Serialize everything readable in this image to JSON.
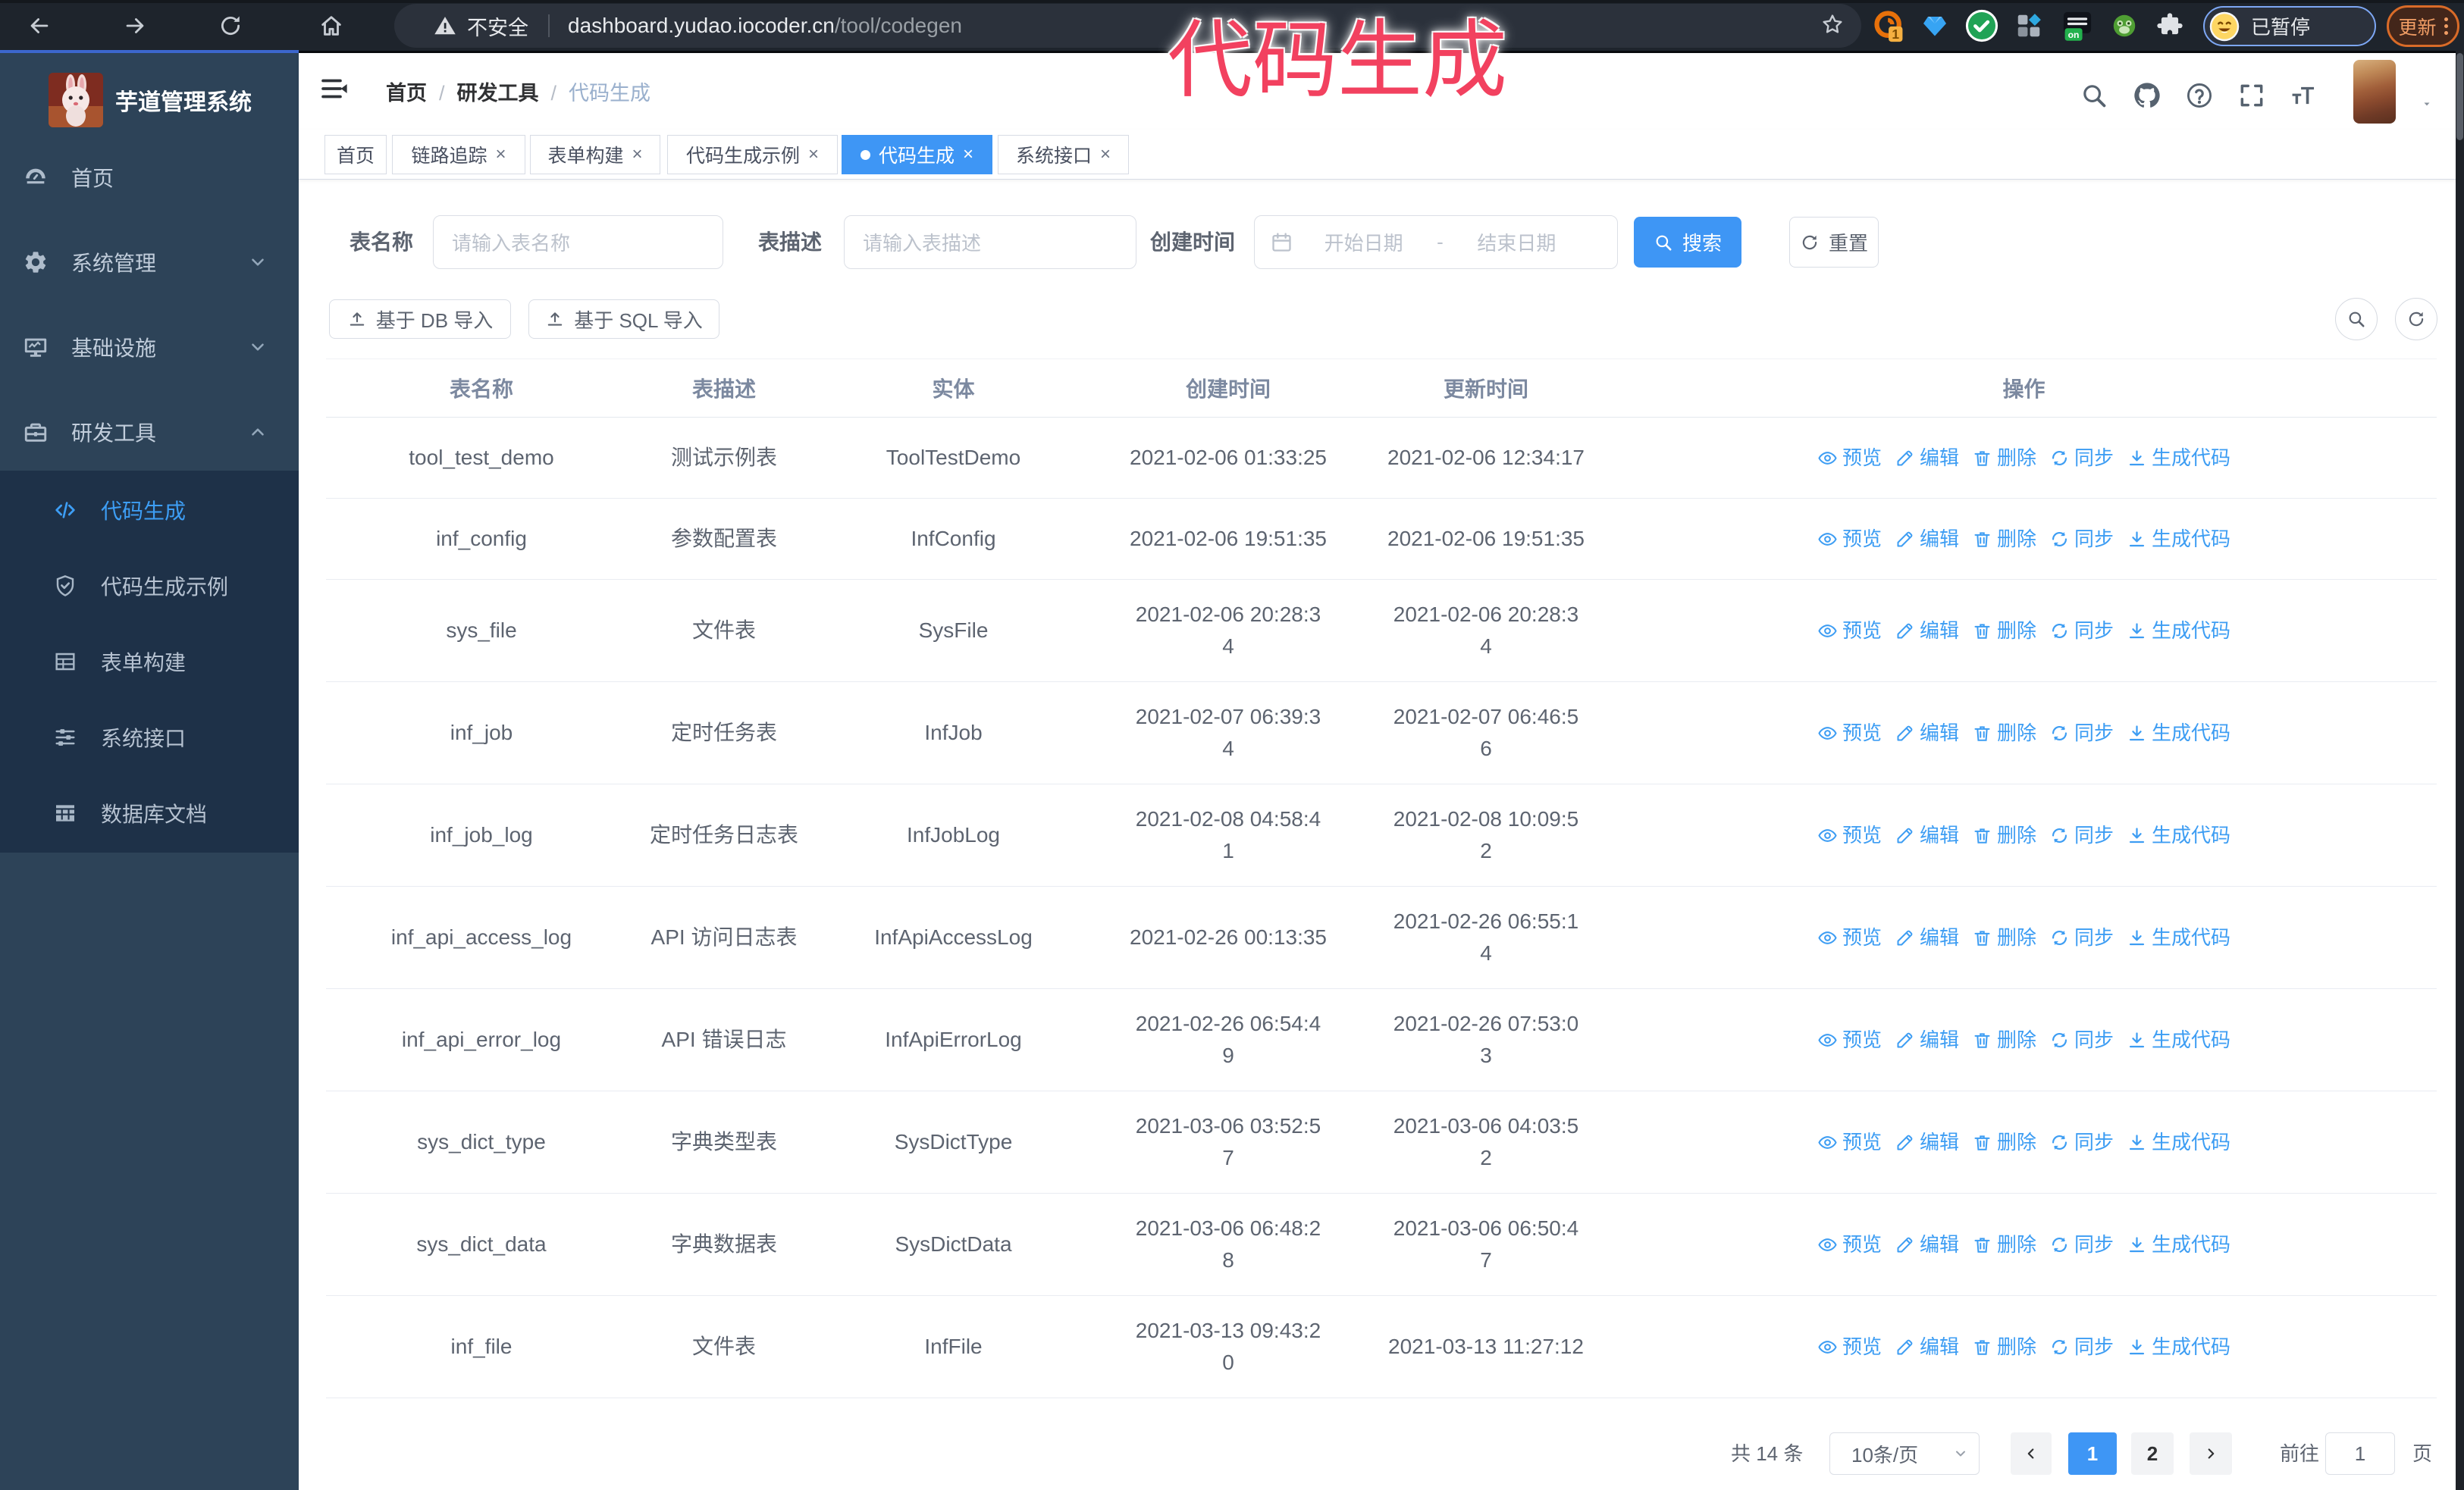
{
  "browser": {
    "security_label": "不安全",
    "url_domain": "dashboard.yudao.iocoder.cn",
    "url_path": "/tool/codegen",
    "profile_status": "已暂停",
    "update_label": "更新",
    "extension_badge": "1",
    "extension_on_badge": "on"
  },
  "annotation": {
    "text": "代码生成"
  },
  "sidebar": {
    "title": "芋道管理系统",
    "menu": [
      {
        "label": "首页",
        "icon": "dashboard-icon"
      },
      {
        "label": "系统管理",
        "icon": "gear-icon",
        "chevron_down": true
      },
      {
        "label": "基础设施",
        "icon": "monitor-icon",
        "chevron_down": true
      },
      {
        "label": "研发工具",
        "icon": "briefcase-icon",
        "chevron_up": true
      }
    ],
    "submenu": [
      {
        "label": "代码生成",
        "icon": "code-icon",
        "active": true
      },
      {
        "label": "代码生成示例",
        "icon": "badge-icon"
      },
      {
        "label": "表单构建",
        "icon": "form-icon"
      },
      {
        "label": "系统接口",
        "icon": "sliders-icon"
      },
      {
        "label": "数据库文档",
        "icon": "database-icon"
      }
    ]
  },
  "header": {
    "breadcrumb": [
      {
        "label": "首页",
        "sep": true
      },
      {
        "label": "研发工具",
        "sep": true
      },
      {
        "label": "代码生成",
        "current": true
      }
    ]
  },
  "tags": [
    {
      "label": "首页"
    },
    {
      "label": "链路追踪",
      "closable": true
    },
    {
      "label": "表单构建",
      "closable": true
    },
    {
      "label": "代码生成示例",
      "closable": true
    },
    {
      "label": "代码生成",
      "closable": true,
      "active": true
    },
    {
      "label": "系统接口",
      "closable": true
    }
  ],
  "filters": {
    "name_label": "表名称",
    "name_placeholder": "请输入表名称",
    "desc_label": "表描述",
    "desc_placeholder": "请输入表描述",
    "time_label": "创建时间",
    "start_placeholder": "开始日期",
    "range_separator": "-",
    "end_placeholder": "结束日期",
    "search_label": "搜索",
    "reset_label": "重置",
    "import_db_label": "基于 DB 导入",
    "import_sql_label": "基于 SQL 导入"
  },
  "table": {
    "columns": [
      "表名称",
      "表描述",
      "实体",
      "创建时间",
      "更新时间",
      "操作"
    ],
    "ops": [
      {
        "label": "预览",
        "icon": "eye-icon"
      },
      {
        "label": "编辑",
        "icon": "edit-icon"
      },
      {
        "label": "删除",
        "icon": "delete-icon"
      },
      {
        "label": "同步",
        "icon": "sync-icon"
      },
      {
        "label": "生成代码",
        "icon": "download-icon"
      }
    ],
    "rows": [
      {
        "name": "tool_test_demo",
        "desc": "测试示例表",
        "entity": "ToolTestDemo",
        "created": "2021-02-06 01:33:25",
        "updated": "2021-02-06 12:34:17"
      },
      {
        "name": "inf_config",
        "desc": "参数配置表",
        "entity": "InfConfig",
        "created": "2021-02-06 19:51:35",
        "updated": "2021-02-06 19:51:35"
      },
      {
        "name": "sys_file",
        "desc": "文件表",
        "entity": "SysFile",
        "created": "2021-02-06 20:28:3\n4",
        "updated": "2021-02-06 20:28:3\n4"
      },
      {
        "name": "inf_job",
        "desc": "定时任务表",
        "entity": "InfJob",
        "created": "2021-02-07 06:39:3\n4",
        "updated": "2021-02-07 06:46:5\n6"
      },
      {
        "name": "inf_job_log",
        "desc": "定时任务日志表",
        "entity": "InfJobLog",
        "created": "2021-02-08 04:58:4\n1",
        "updated": "2021-02-08 10:09:5\n2"
      },
      {
        "name": "inf_api_access_log",
        "desc": "API 访问日志表",
        "entity": "InfApiAccessLog",
        "created": "2021-02-26 00:13:35",
        "updated": "2021-02-26 06:55:1\n4"
      },
      {
        "name": "inf_api_error_log",
        "desc": "API 错误日志",
        "entity": "InfApiErrorLog",
        "created": "2021-02-26 06:54:4\n9",
        "updated": "2021-02-26 07:53:0\n3"
      },
      {
        "name": "sys_dict_type",
        "desc": "字典类型表",
        "entity": "SysDictType",
        "created": "2021-03-06 03:52:5\n7",
        "updated": "2021-03-06 04:03:5\n2"
      },
      {
        "name": "sys_dict_data",
        "desc": "字典数据表",
        "entity": "SysDictData",
        "created": "2021-03-06 06:48:2\n8",
        "updated": "2021-03-06 06:50:4\n7"
      },
      {
        "name": "inf_file",
        "desc": "文件表",
        "entity": "InfFile",
        "created": "2021-03-13 09:43:2\n0",
        "updated": "2021-03-13 11:27:12"
      }
    ]
  },
  "pagination": {
    "total": "共 14 条",
    "page_size": "10条/页",
    "pages": [
      {
        "num": "1",
        "active": true
      },
      {
        "num": "2"
      }
    ],
    "jumper_label": "前往",
    "jumper_value": "1",
    "jumper_unit": "页"
  }
}
